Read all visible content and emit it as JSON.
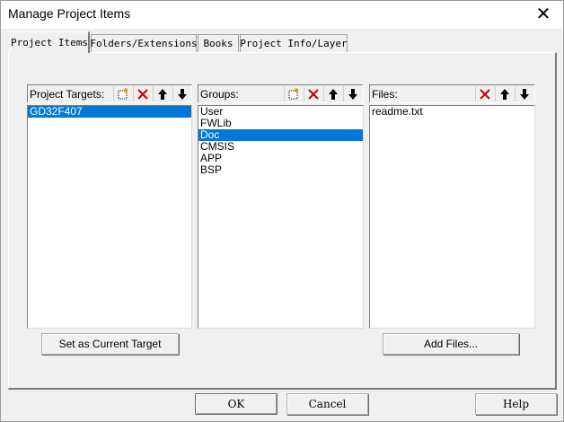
{
  "window": {
    "title": "Manage Project Items",
    "close_glyph": "✕"
  },
  "tabs": [
    {
      "label": "Project Items",
      "active": true
    },
    {
      "label": "Folders/Extensions",
      "active": false
    },
    {
      "label": "Books",
      "active": false
    },
    {
      "label": "Project Info/Layer",
      "active": false
    }
  ],
  "targets": {
    "label": "Project Targets:",
    "items": [
      "GD32F407"
    ],
    "selected": "GD32F407",
    "tools": [
      "new-icon",
      "delete-icon",
      "move-up-icon",
      "move-down-icon"
    ]
  },
  "groups": {
    "label": "Groups:",
    "items": [
      "User",
      "FWLib",
      "Doc",
      "CMSIS",
      "APP",
      "BSP"
    ],
    "selected": "Doc",
    "tools": [
      "new-icon",
      "delete-icon",
      "move-up-icon",
      "move-down-icon"
    ]
  },
  "files": {
    "label": "Files:",
    "items": [
      "readme.txt"
    ],
    "tools": [
      "delete-icon",
      "move-up-icon",
      "move-down-icon"
    ]
  },
  "buttons": {
    "set_current": "Set as Current Target",
    "add_files": "Add Files...",
    "ok": "OK",
    "cancel": "Cancel",
    "help": "Help"
  },
  "colors": {
    "selection": "#0078d7",
    "delete_icon": "#c00000"
  }
}
